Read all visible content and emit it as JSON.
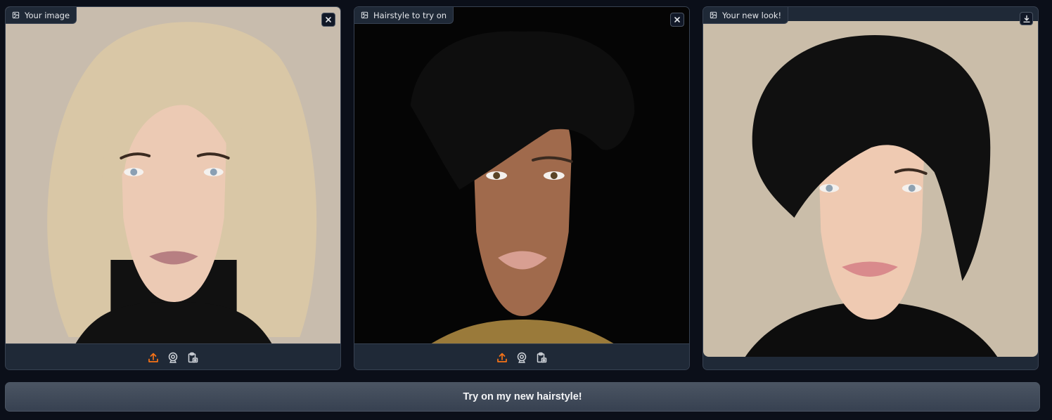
{
  "panels": [
    {
      "label": "Your image",
      "corner_icon": "close-icon",
      "toolbar": [
        "upload-icon",
        "webcam-icon",
        "clipboard-icon"
      ],
      "portrait": {
        "background": "#c8bcad",
        "hair": "#d9c7a6",
        "skin": "#eccab4",
        "clothing": "#111111",
        "iris": "#8a9fb3",
        "lips": "#b77f82"
      }
    },
    {
      "label": "Hairstyle to try on",
      "corner_icon": "close-icon",
      "toolbar": [
        "upload-icon",
        "webcam-icon",
        "clipboard-icon"
      ],
      "portrait": {
        "background": "#050505",
        "hair": "#0e0e0e",
        "skin": "#a06a4c",
        "clothing": "#9a7a3a",
        "iris": "#5a4426",
        "lips": "#d89f92"
      }
    },
    {
      "label": "Your new look!",
      "corner_icon": "download-icon",
      "toolbar": [],
      "portrait": {
        "background": "#cabda9",
        "hair": "#101010",
        "skin": "#efcab2",
        "clothing": "#0d0d0d",
        "iris": "#8fa1b0",
        "lips": "#d98a8c"
      }
    }
  ],
  "submit_button": {
    "label": "Try on my new hairstyle!"
  },
  "colors": {
    "page_bg": "#0b0f19",
    "panel_bg": "#1f2937",
    "border": "#374151",
    "accent": "#f97316"
  }
}
